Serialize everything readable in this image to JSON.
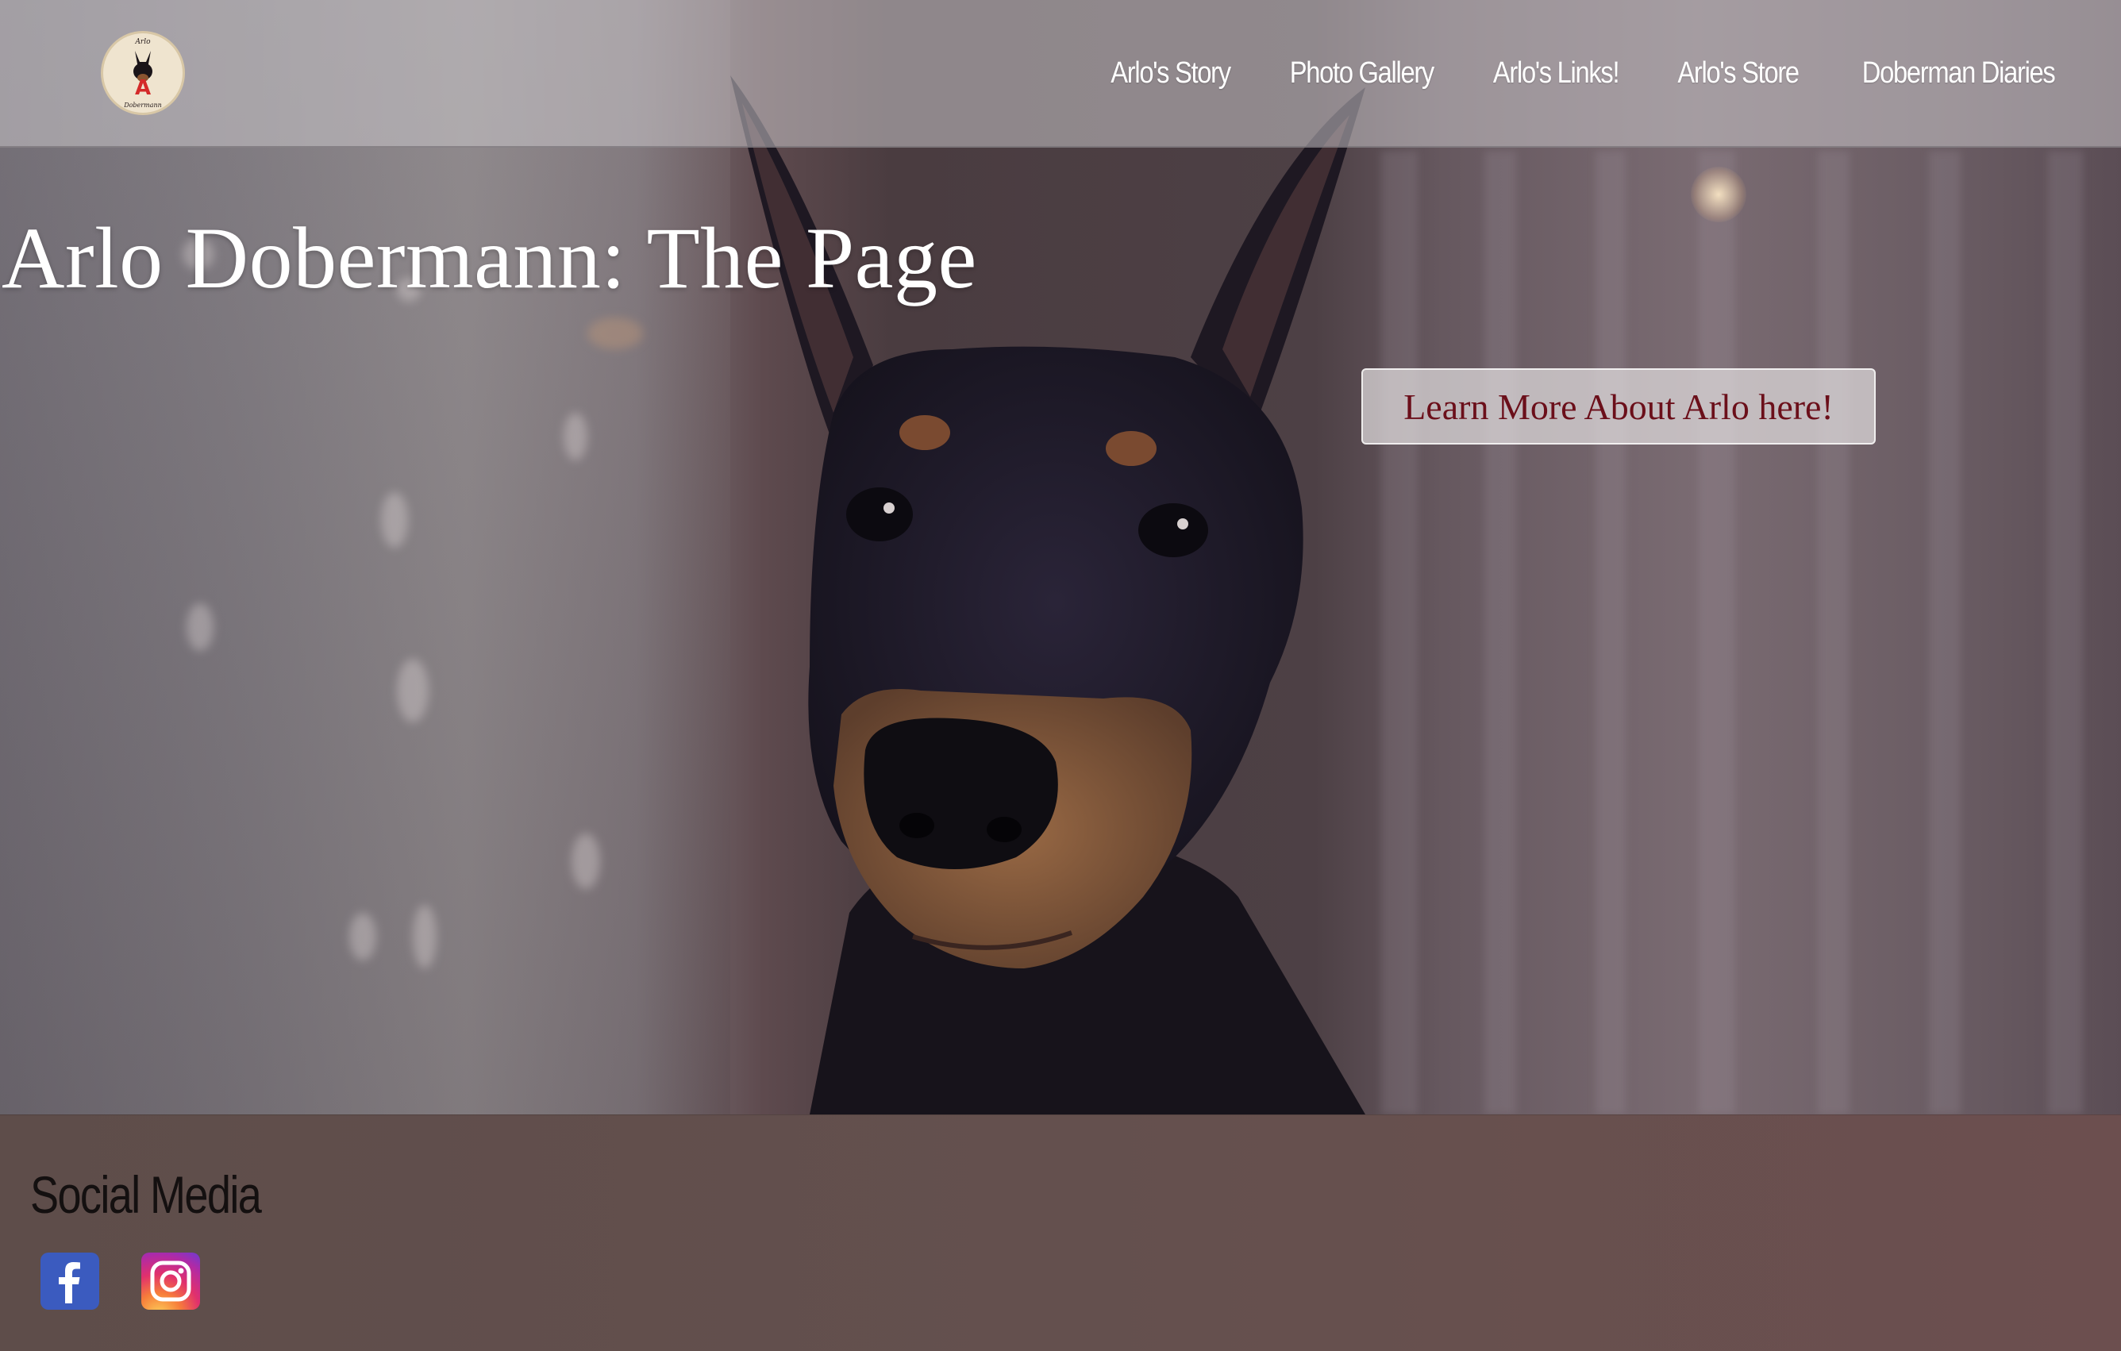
{
  "nav": {
    "logo": {
      "icon": "doberman-logo-icon",
      "text_top": "Arlo",
      "letter": "A",
      "text_bottom": "Dobermann"
    },
    "links": [
      {
        "label": "Arlo's Story"
      },
      {
        "label": "Photo Gallery"
      },
      {
        "label": "Arlo's Links!"
      },
      {
        "label": "Arlo's Store"
      },
      {
        "label": "Doberman Diaries"
      }
    ]
  },
  "hero": {
    "title": "Arlo Dobermann: The Page",
    "cta_label": "Learn More About Arlo here!",
    "background_image": "doberman-portrait-photo"
  },
  "footer": {
    "title": "Social Media",
    "icons": [
      {
        "name": "facebook-icon",
        "color": "#3b5bbf"
      },
      {
        "name": "instagram-icon",
        "color": "#e1306c"
      }
    ]
  },
  "colors": {
    "cta_text": "#6b0f1a",
    "footer_bg": "#64504e",
    "nav_text": "#ffffff"
  }
}
